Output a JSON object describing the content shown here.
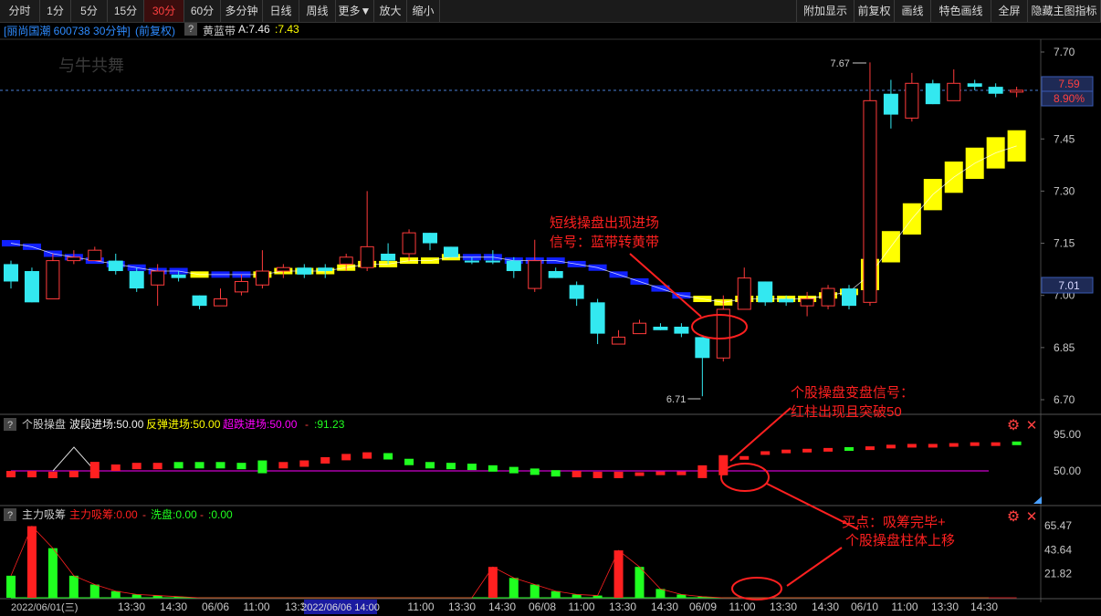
{
  "toolbar": {
    "left": [
      "分时",
      "1分",
      "5分",
      "15分",
      "30分",
      "60分",
      "多分钟",
      "日线",
      "周线",
      "更多▼",
      "放大",
      "缩小"
    ],
    "active_index": 4,
    "right": [
      "附加显示",
      "前复权",
      "画线",
      "特色画线",
      "全屏",
      "隐藏主图指标"
    ]
  },
  "header": {
    "stock": "[丽尚国潮 600738 30分钟]",
    "adjust": "(前复权)",
    "indicator": "黄蓝带",
    "a_label": "A:7.46",
    "a_value": ":7.43"
  },
  "watermark": "与牛共舞",
  "main_axis": {
    "ticks": [
      "7.70",
      "7.45",
      "7.30",
      "7.15",
      "7.00",
      "6.85",
      "6.70"
    ],
    "current_price": "7.59",
    "current_pct": "8.90%",
    "band_price": "7.01"
  },
  "price_marks": {
    "high": "7.67",
    "low": "6.71"
  },
  "annotations": {
    "signal1": [
      "短线操盘出现进场",
      "信号：蓝带转黄带"
    ],
    "signal2": [
      "个股操盘变盘信号：",
      "红柱出现且突破50"
    ],
    "signal3": [
      "买点：吸筹完毕+",
      "个股操盘柱体上移"
    ]
  },
  "panel1": {
    "title": "个股操盘",
    "l1": "波段进场:50.00",
    "l2": "反弹进场:50.00",
    "l3": "超跌进场:50.00",
    "l4": ":91.23",
    "axis": [
      "95.00",
      "50.00"
    ]
  },
  "panel2": {
    "title": "主力吸筹",
    "l1": "主力吸筹:0.00",
    "l2": "洗盘:0.00",
    "l3": ":0.00",
    "axis": [
      "65.47",
      "43.64",
      "21.82"
    ]
  },
  "time_axis": {
    "labels": [
      "2022/06/01(三)",
      "13:30",
      "14:30",
      "06/06",
      "11:00",
      "13:30",
      "2022/06/06 14:00",
      "11:00",
      "13:30",
      "14:30",
      "06/08",
      "11:00",
      "13:30",
      "14:30",
      "06/09",
      "11:00",
      "13:30",
      "14:30",
      "06/10",
      "11:00",
      "13:30",
      "14:30"
    ]
  },
  "chart_data": {
    "type": "candlestick",
    "title": "丽尚国潮 600738 30分钟",
    "period": "30分钟",
    "ylim": [
      6.68,
      7.74
    ],
    "candles": [
      {
        "o": 7.04,
        "c": 7.09,
        "h": 7.1,
        "l": 7.02,
        "up": false
      },
      {
        "o": 7.07,
        "c": 6.98,
        "h": 7.08,
        "l": 6.98,
        "up": false
      },
      {
        "o": 6.99,
        "c": 7.1,
        "h": 7.12,
        "l": 6.99,
        "up": true
      },
      {
        "o": 7.1,
        "c": 7.11,
        "h": 7.13,
        "l": 7.09,
        "up": true
      },
      {
        "o": 7.1,
        "c": 7.13,
        "h": 7.14,
        "l": 7.1,
        "up": true
      },
      {
        "o": 7.1,
        "c": 7.07,
        "h": 7.12,
        "l": 7.06,
        "up": false
      },
      {
        "o": 7.07,
        "c": 7.02,
        "h": 7.08,
        "l": 7.01,
        "up": false
      },
      {
        "o": 7.03,
        "c": 7.07,
        "h": 7.09,
        "l": 6.97,
        "up": true
      },
      {
        "o": 7.06,
        "c": 7.05,
        "h": 7.07,
        "l": 7.04,
        "up": false
      },
      {
        "o": 7.0,
        "c": 6.97,
        "h": 7.0,
        "l": 6.96,
        "up": false
      },
      {
        "o": 6.97,
        "c": 6.99,
        "h": 7.02,
        "l": 6.97,
        "up": true
      },
      {
        "o": 7.01,
        "c": 7.04,
        "h": 7.06,
        "l": 7.0,
        "up": true
      },
      {
        "o": 7.03,
        "c": 7.07,
        "h": 7.13,
        "l": 7.02,
        "up": true
      },
      {
        "o": 7.07,
        "c": 7.08,
        "h": 7.09,
        "l": 7.05,
        "up": true
      },
      {
        "o": 7.08,
        "c": 7.06,
        "h": 7.09,
        "l": 7.05,
        "up": false
      },
      {
        "o": 7.08,
        "c": 7.07,
        "h": 7.09,
        "l": 7.05,
        "up": false
      },
      {
        "o": 7.09,
        "c": 7.11,
        "h": 7.12,
        "l": 7.07,
        "up": true
      },
      {
        "o": 7.08,
        "c": 7.14,
        "h": 7.3,
        "l": 7.07,
        "up": true
      },
      {
        "o": 7.12,
        "c": 7.1,
        "h": 7.15,
        "l": 7.09,
        "up": false
      },
      {
        "o": 7.12,
        "c": 7.18,
        "h": 7.19,
        "l": 7.1,
        "up": true
      },
      {
        "o": 7.18,
        "c": 7.15,
        "h": 7.18,
        "l": 7.13,
        "up": false
      },
      {
        "o": 7.14,
        "c": 7.11,
        "h": 7.14,
        "l": 7.11,
        "up": false
      },
      {
        "o": 7.1,
        "c": 7.1,
        "h": 7.11,
        "l": 7.09,
        "up": false
      },
      {
        "o": 7.1,
        "c": 7.1,
        "h": 7.13,
        "l": 7.09,
        "up": false
      },
      {
        "o": 7.1,
        "c": 7.07,
        "h": 7.11,
        "l": 7.05,
        "up": false
      },
      {
        "o": 7.02,
        "c": 7.1,
        "h": 7.16,
        "l": 7.01,
        "up": true
      },
      {
        "o": 7.07,
        "c": 7.05,
        "h": 7.08,
        "l": 7.05,
        "up": false
      },
      {
        "o": 7.03,
        "c": 6.99,
        "h": 7.04,
        "l": 6.97,
        "up": false
      },
      {
        "o": 6.98,
        "c": 6.89,
        "h": 6.99,
        "l": 6.86,
        "up": false
      },
      {
        "o": 6.86,
        "c": 6.88,
        "h": 6.9,
        "l": 6.86,
        "up": true
      },
      {
        "o": 6.89,
        "c": 6.92,
        "h": 6.93,
        "l": 6.89,
        "up": true
      },
      {
        "o": 6.91,
        "c": 6.9,
        "h": 6.92,
        "l": 6.9,
        "up": false
      },
      {
        "o": 6.91,
        "c": 6.89,
        "h": 6.92,
        "l": 6.88,
        "up": false
      },
      {
        "o": 6.88,
        "c": 6.82,
        "h": 6.88,
        "l": 6.71,
        "up": false
      },
      {
        "o": 6.82,
        "c": 6.96,
        "h": 7.0,
        "l": 6.81,
        "up": true
      },
      {
        "o": 6.96,
        "c": 7.05,
        "h": 7.08,
        "l": 6.96,
        "up": true
      },
      {
        "o": 7.04,
        "c": 6.98,
        "h": 7.04,
        "l": 6.97,
        "up": false
      },
      {
        "o": 6.98,
        "c": 6.99,
        "h": 7.0,
        "l": 6.97,
        "up": false
      },
      {
        "o": 6.97,
        "c": 6.99,
        "h": 7.01,
        "l": 6.94,
        "up": true
      },
      {
        "o": 6.97,
        "c": 7.02,
        "h": 7.03,
        "l": 6.96,
        "up": true
      },
      {
        "o": 7.02,
        "c": 6.97,
        "h": 7.03,
        "l": 6.96,
        "up": false
      },
      {
        "o": 6.98,
        "c": 7.56,
        "h": 7.67,
        "l": 6.97,
        "up": true
      },
      {
        "o": 7.58,
        "c": 7.52,
        "h": 7.62,
        "l": 7.48,
        "up": false
      },
      {
        "o": 7.51,
        "c": 7.61,
        "h": 7.64,
        "l": 7.5,
        "up": true
      },
      {
        "o": 7.61,
        "c": 7.55,
        "h": 7.62,
        "l": 7.55,
        "up": false
      },
      {
        "o": 7.56,
        "c": 7.61,
        "h": 7.65,
        "l": 7.56,
        "up": true
      },
      {
        "o": 7.61,
        "c": 7.6,
        "h": 7.62,
        "l": 7.59,
        "up": false
      },
      {
        "o": 7.6,
        "c": 7.58,
        "h": 7.61,
        "l": 7.57,
        "up": false
      },
      {
        "o": 7.59,
        "c": 7.59,
        "h": 7.6,
        "l": 7.57,
        "up": true
      }
    ],
    "band": {
      "colors": [
        "blue",
        "blue",
        "blue",
        "blue",
        "blue",
        "blue",
        "blue",
        "blue",
        "blue",
        "yellow",
        "blue",
        "blue",
        "yellow",
        "yellow",
        "yellow",
        "yellow",
        "yellow",
        "yellow",
        "yellow",
        "yellow",
        "yellow",
        "yellow",
        "blue",
        "blue",
        "blue",
        "blue",
        "blue",
        "blue",
        "blue",
        "blue",
        "blue",
        "blue",
        "blue",
        "yellow",
        "yellow",
        "yellow",
        "yellow",
        "yellow",
        "yellow",
        "yellow",
        "yellow",
        "yellow",
        "yellow",
        "yellow",
        "yellow",
        "yellow",
        "yellow",
        "yellow",
        "yellow"
      ],
      "values": [
        7.15,
        7.14,
        7.12,
        7.11,
        7.1,
        7.09,
        7.08,
        7.07,
        7.07,
        7.06,
        7.06,
        7.06,
        7.06,
        7.07,
        7.07,
        7.07,
        7.08,
        7.09,
        7.09,
        7.1,
        7.1,
        7.11,
        7.11,
        7.11,
        7.1,
        7.1,
        7.1,
        7.09,
        7.08,
        7.06,
        7.04,
        7.02,
        7.0,
        6.99,
        6.98,
        6.99,
        6.99,
        6.99,
        6.99,
        7.0,
        7.01,
        7.06,
        7.14,
        7.22,
        7.29,
        7.34,
        7.38,
        7.41,
        7.43
      ]
    },
    "panel1_values": [
      46,
      46,
      45,
      46,
      51,
      54,
      56,
      56,
      57,
      57,
      57,
      56,
      55,
      57,
      59,
      63,
      67,
      69,
      68,
      61,
      57,
      56,
      55,
      53,
      51,
      49,
      47,
      46,
      45,
      45,
      46,
      47,
      47,
      49,
      57,
      66,
      72,
      74,
      75,
      76,
      77,
      78,
      80,
      81,
      81,
      82,
      83,
      83,
      84
    ],
    "panel1_red": [
      true,
      true,
      true,
      true,
      true,
      true,
      true,
      true,
      false,
      false,
      false,
      false,
      false,
      true,
      true,
      true,
      true,
      true,
      false,
      false,
      false,
      false,
      false,
      false,
      false,
      false,
      false,
      true,
      true,
      true,
      true,
      true,
      true,
      true,
      true,
      true,
      true,
      true,
      true,
      true,
      false,
      true,
      true,
      true,
      true,
      true,
      true,
      true,
      false
    ],
    "panel2_values": [
      20,
      65,
      45,
      20,
      12,
      6,
      3,
      2,
      1,
      0,
      0,
      0,
      0,
      0,
      0,
      0,
      0,
      0,
      0,
      0,
      0,
      0,
      0,
      28,
      18,
      12,
      6,
      3,
      2,
      43,
      28,
      8,
      3,
      1,
      0,
      0,
      0,
      0,
      0,
      0,
      0,
      0,
      0,
      0,
      0,
      0,
      0,
      0,
      0
    ],
    "panel2_red": [
      false,
      true,
      false,
      false,
      false,
      false,
      false,
      false,
      false,
      false,
      false,
      false,
      false,
      false,
      false,
      false,
      false,
      false,
      false,
      false,
      false,
      false,
      false,
      true,
      false,
      false,
      false,
      false,
      false,
      true,
      false,
      false,
      false,
      false,
      false,
      false,
      false,
      false,
      false,
      false,
      false,
      false,
      false,
      false,
      false,
      false,
      false,
      false,
      false
    ],
    "colors": {
      "up": "#ff3b3b",
      "down": "#33e8f0",
      "band_yellow": "#ffff00",
      "band_blue": "#1020ff",
      "panel_red": "#ff2020",
      "panel_green": "#20ff20",
      "line_purple": "#ff00ff"
    }
  }
}
